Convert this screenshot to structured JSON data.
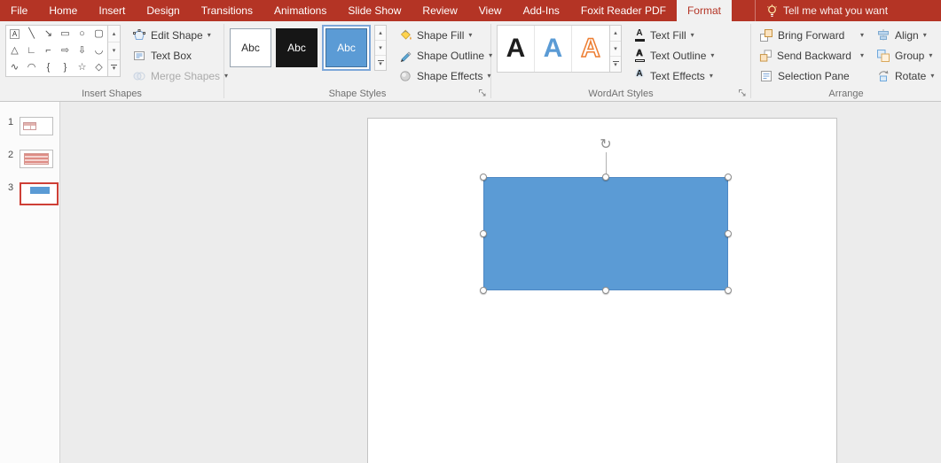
{
  "titlebar": {
    "tabs": [
      "File",
      "Home",
      "Insert",
      "Design",
      "Transitions",
      "Animations",
      "Slide Show",
      "Review",
      "View",
      "Add-Ins",
      "Foxit Reader PDF",
      "Format"
    ],
    "active_tab": "Format",
    "tell_me_label": "Tell me what you want"
  },
  "ribbon": {
    "insert_shapes": {
      "label": "Insert Shapes",
      "gallery": [
        "A",
        "╲",
        "↘",
        "▭",
        "○",
        "▢",
        "△",
        "∟",
        "⌐",
        "⇨",
        "⇩",
        "◡",
        "∿",
        "◠",
        "{",
        "}",
        "☆",
        "◇"
      ],
      "buttons": {
        "edit_shape": "Edit Shape",
        "text_box": "Text Box",
        "merge_shapes": "Merge Shapes"
      }
    },
    "shape_styles": {
      "label": "Shape Styles",
      "swatch_label": "Abc",
      "buttons": {
        "shape_fill": "Shape Fill",
        "shape_outline": "Shape Outline",
        "shape_effects": "Shape Effects"
      }
    },
    "wordart_styles": {
      "label": "WordArt Styles",
      "preview_letter": "A",
      "buttons": {
        "text_fill": "Text Fill",
        "text_outline": "Text Outline",
        "text_effects": "Text Effects"
      }
    },
    "arrange": {
      "label": "Arrange",
      "buttons": {
        "bring_forward": "Bring Forward",
        "send_backward": "Send Backward",
        "selection_pane": "Selection Pane",
        "align": "Align",
        "group": "Group",
        "rotate": "Rotate"
      }
    }
  },
  "slide_panel": {
    "slides": [
      {
        "number": "1",
        "selected": false
      },
      {
        "number": "2",
        "selected": false
      },
      {
        "number": "3",
        "selected": true
      }
    ]
  },
  "glyphs": {
    "dropdown": "▾",
    "scroll_up": "▴",
    "scroll_down": "▾",
    "rotate": "↻",
    "letter_a": "A"
  },
  "colors": {
    "titlebar_red": "#B43425",
    "active_tab_text": "#B43425",
    "shape_fill_blue": "#5B9BD5",
    "shape_outline_blue": "#41719C",
    "wordart_orange": "#ED7D31",
    "selected_thumb_border": "#CE3F36"
  },
  "icons": [
    "lightbulb-icon",
    "edit-shape-icon",
    "text-box-icon",
    "merge-shapes-icon",
    "shape-fill-icon",
    "shape-outline-icon",
    "shape-effects-icon",
    "text-fill-icon",
    "text-outline-icon",
    "text-effects-icon",
    "bring-forward-icon",
    "send-backward-icon",
    "selection-pane-icon",
    "align-icon",
    "group-icon",
    "rotate-icon",
    "dialog-launcher-icon",
    "dropdown-arrow-icon",
    "scroll-up-icon",
    "scroll-down-icon",
    "gallery-more-icon",
    "rotation-handle-icon"
  ]
}
